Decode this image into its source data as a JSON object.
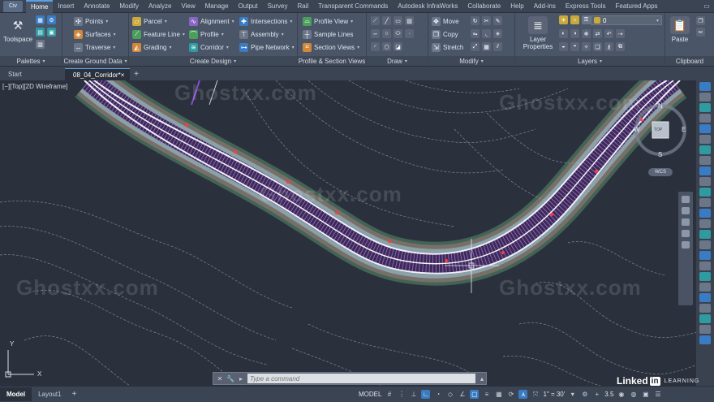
{
  "app_button": "Civ",
  "ribbon_tabs": [
    {
      "label": "Home",
      "active": true
    },
    {
      "label": "Insert"
    },
    {
      "label": "Annotate"
    },
    {
      "label": "Modify"
    },
    {
      "label": "Analyze"
    },
    {
      "label": "View"
    },
    {
      "label": "Manage"
    },
    {
      "label": "Output"
    },
    {
      "label": "Survey"
    },
    {
      "label": "Rail"
    },
    {
      "label": "Transparent Commands"
    },
    {
      "label": "Autodesk InfraWorks"
    },
    {
      "label": "Collaborate"
    },
    {
      "label": "Help"
    },
    {
      "label": "Add-ins"
    },
    {
      "label": "Express Tools"
    },
    {
      "label": "Featured Apps"
    }
  ],
  "panels": {
    "palettes": {
      "title": "Palettes",
      "toolspace": "Toolspace"
    },
    "ground_data": {
      "title": "Create Ground Data",
      "items": [
        "Points",
        "Surfaces",
        "Traverse"
      ]
    },
    "design": {
      "title": "Create Design",
      "col1": [
        "Parcel",
        "Feature Line",
        "Grading"
      ],
      "col2": [
        "Alignment",
        "Profile",
        "Corridor"
      ],
      "col3": [
        "Intersections",
        "Assembly",
        "Pipe Network"
      ]
    },
    "profile_section": {
      "title": "Profile & Section Views",
      "items": [
        "Profile View",
        "Sample Lines",
        "Section Views"
      ]
    },
    "draw": {
      "title": "Draw"
    },
    "modify": {
      "title": "Modify",
      "items": [
        "Move",
        "Copy",
        "Stretch"
      ]
    },
    "layers": {
      "title": "Layers",
      "layer_properties": "Layer Properties",
      "current_layer": "0"
    },
    "clipboard": {
      "title": "Clipboard",
      "paste": "Paste"
    }
  },
  "doc_tabs": [
    {
      "label": "Start"
    },
    {
      "label": "08_04_Corridor*",
      "active": true
    }
  ],
  "viewport_label": "[−][Top][2D Wireframe]",
  "viewcube": {
    "north": "N",
    "south": "S",
    "east": "E",
    "west": "W",
    "top": "TOP",
    "wcs": "WCS"
  },
  "ucs": {
    "x": "X",
    "y": "Y"
  },
  "watermark": "Ghostxx.com",
  "command_placeholder": "Type a command",
  "layout_tabs": [
    {
      "label": "Model",
      "active": true
    },
    {
      "label": "Layout1"
    }
  ],
  "status": {
    "model": "MODEL",
    "scale": "1\" = 30'",
    "value": "3.5"
  },
  "branding": {
    "linked": "Linked",
    "in": "in",
    "learning": "LEARNING"
  },
  "colors": {
    "accent": "#3a7cc4",
    "ribbon": "#4a5568",
    "canvas": "#2b313c"
  }
}
